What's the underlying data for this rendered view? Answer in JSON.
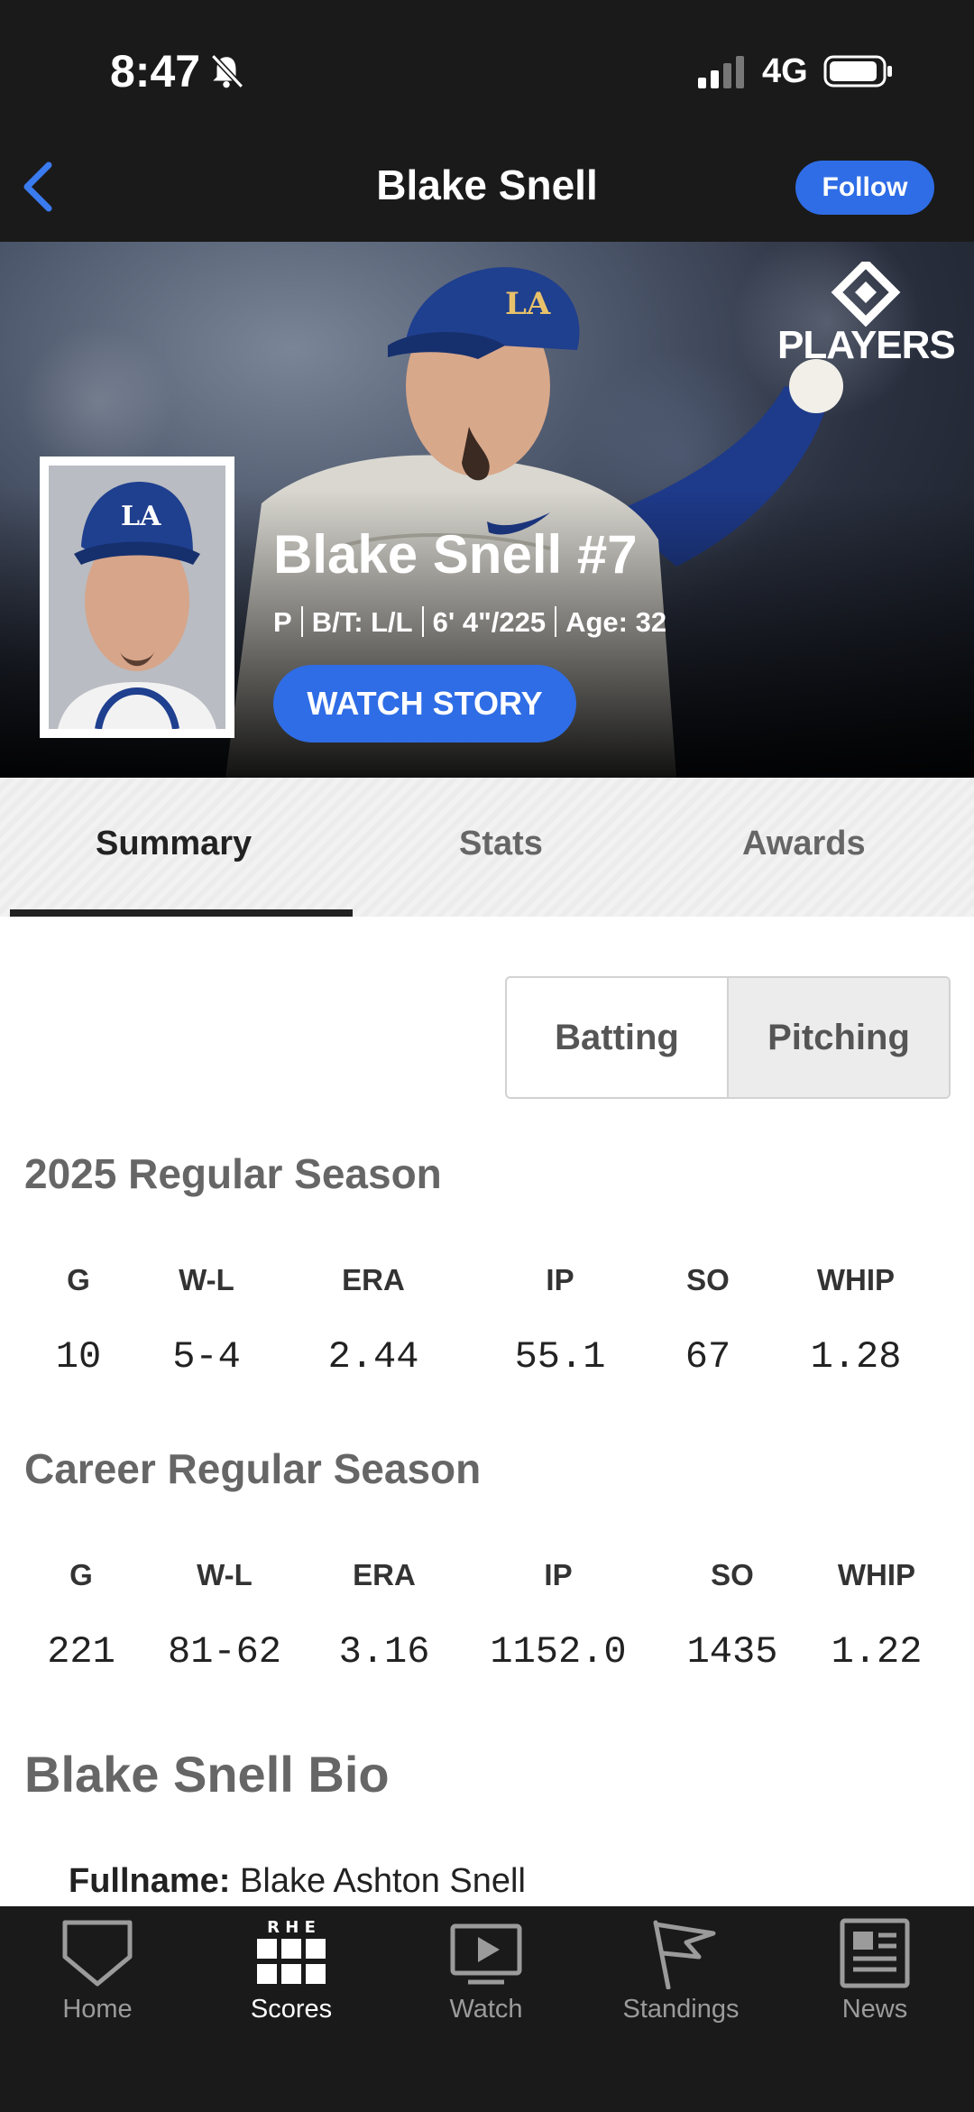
{
  "status": {
    "time": "8:47",
    "network": "4G"
  },
  "nav": {
    "title": "Blake Snell",
    "follow_label": "Follow"
  },
  "hero": {
    "logo_text": "PLAYERS",
    "name": "Blake Snell #7",
    "meta": [
      "P",
      "B/T: L/L",
      "6' 4\"/225",
      "Age: 32"
    ],
    "watch_label": "WATCH STORY"
  },
  "tabs": [
    {
      "label": "Summary",
      "active": true
    },
    {
      "label": "Stats",
      "active": false
    },
    {
      "label": "Awards",
      "active": false
    }
  ],
  "toggle": {
    "batting": "Batting",
    "pitching": "Pitching",
    "selected": "Pitching"
  },
  "season": {
    "title": "2025 Regular Season",
    "headers": [
      "G",
      "W-L",
      "ERA",
      "IP",
      "SO",
      "WHIP"
    ],
    "values": [
      "10",
      "5-4",
      "2.44",
      "55.1",
      "67",
      "1.28"
    ]
  },
  "career": {
    "title": "Career Regular Season",
    "headers": [
      "G",
      "W-L",
      "ERA",
      "IP",
      "SO",
      "WHIP"
    ],
    "values": [
      "221",
      "81-62",
      "3.16",
      "1152.0",
      "1435",
      "1.22"
    ]
  },
  "bio": {
    "title": "Blake Snell Bio",
    "fullname_label": "Fullname:",
    "fullname": "Blake Ashton Snell"
  },
  "bottom_nav": {
    "home": "Home",
    "scores": "Scores",
    "scores_icon_text": "R H E",
    "watch": "Watch",
    "standings": "Standings",
    "news": "News"
  },
  "colors": {
    "accent": "#2f6de6",
    "bar": "#1a1a1a"
  }
}
